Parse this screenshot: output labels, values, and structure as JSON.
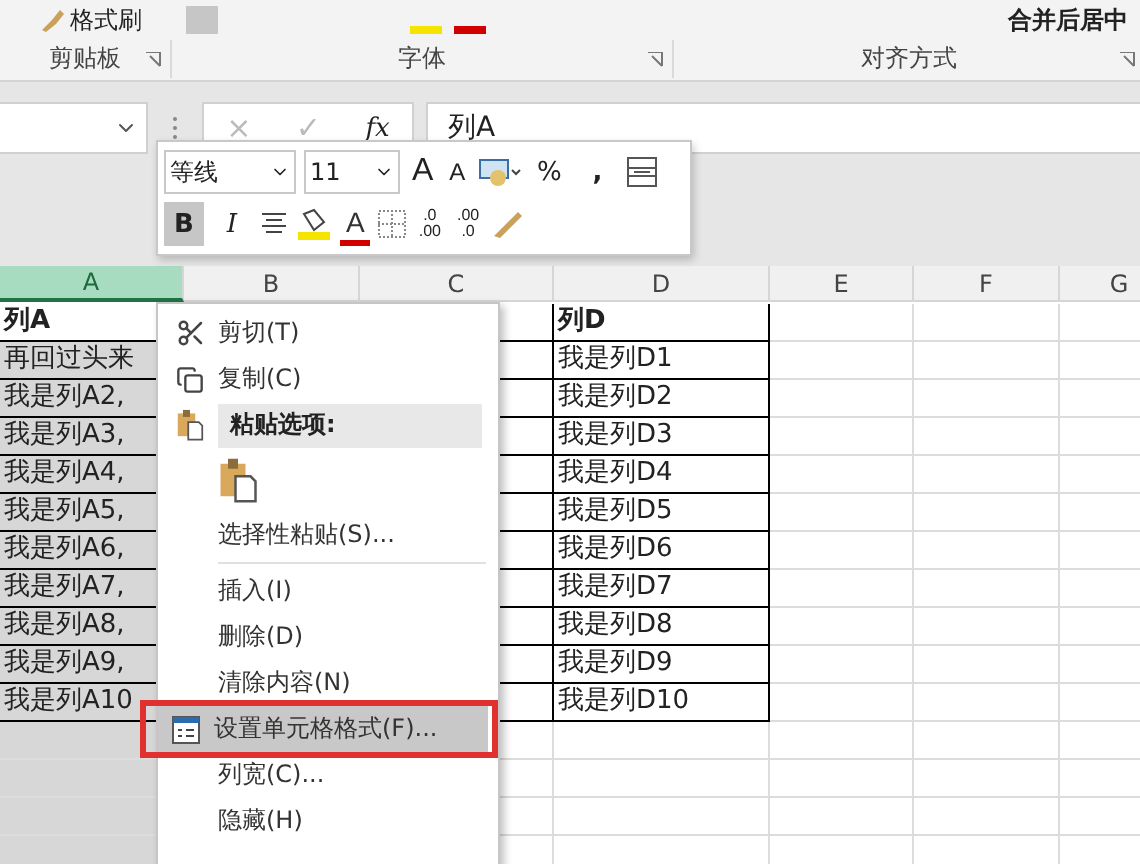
{
  "ribbon": {
    "format_painter": "格式刷",
    "merge_button": "合并后居中",
    "groups": [
      {
        "label": "剪贴板"
      },
      {
        "label": "字体"
      },
      {
        "label": "对齐方式"
      }
    ]
  },
  "formula_bar": {
    "cancel": "×",
    "enter": "✓",
    "fx": "fx",
    "value": "列A"
  },
  "columns": [
    {
      "label": "A",
      "selected": true
    },
    {
      "label": "B",
      "selected": false
    },
    {
      "label": "C",
      "selected": false
    },
    {
      "label": "D",
      "selected": false
    },
    {
      "label": "E",
      "selected": false
    },
    {
      "label": "F",
      "selected": false
    },
    {
      "label": "G",
      "selected": false
    }
  ],
  "rows": [
    {
      "a": "列A",
      "d": "列D",
      "header": true,
      "active": true
    },
    {
      "a": "再回过头来",
      "d": "我是列D1",
      "header": false,
      "active": false
    },
    {
      "a": "我是列A2,",
      "d": "我是列D2",
      "header": false,
      "active": false
    },
    {
      "a": "我是列A3,",
      "d": "我是列D3",
      "header": false,
      "active": false
    },
    {
      "a": "我是列A4,",
      "d": "我是列D4",
      "header": false,
      "active": false
    },
    {
      "a": "我是列A5,",
      "d": "我是列D5",
      "header": false,
      "active": false
    },
    {
      "a": "我是列A6,",
      "d": "我是列D6",
      "header": false,
      "active": false
    },
    {
      "a": "我是列A7,",
      "d": "我是列D7",
      "header": false,
      "active": false
    },
    {
      "a": "我是列A8,",
      "d": "我是列D8",
      "header": false,
      "active": false
    },
    {
      "a": "我是列A9,",
      "d": "我是列D9",
      "header": false,
      "active": false
    },
    {
      "a": "我是列A10",
      "d": "我是列D10",
      "header": false,
      "active": false
    }
  ],
  "mini_toolbar": {
    "font": "等线",
    "size": "11",
    "grow": "A",
    "shrink": "A",
    "percent": "%",
    "comma": ",",
    "bold": "B",
    "bold_pressed": true,
    "italic": "I",
    "font_color": "A",
    "dec_inc": [
      ".0",
      ".00"
    ],
    "dec_dec": [
      ".00",
      ".0"
    ]
  },
  "context_menu": [
    {
      "kind": "cut",
      "label": "剪切(T)",
      "highlighted": false,
      "annotated": false
    },
    {
      "kind": "copy",
      "label": "复制(C)",
      "highlighted": false,
      "annotated": false
    },
    {
      "kind": "header",
      "label": "粘贴选项:"
    },
    {
      "kind": "paste"
    },
    {
      "kind": "plain",
      "label": "选择性粘贴(S)...",
      "highlighted": false,
      "annotated": false
    },
    {
      "kind": "separator"
    },
    {
      "kind": "plain",
      "label": "插入(I)",
      "highlighted": false,
      "annotated": false
    },
    {
      "kind": "plain",
      "label": "删除(D)",
      "highlighted": false,
      "annotated": false
    },
    {
      "kind": "plain",
      "label": "清除内容(N)",
      "highlighted": false,
      "annotated": false
    },
    {
      "kind": "format",
      "label": "设置单元格格式(F)...",
      "highlighted": true,
      "annotated": true
    },
    {
      "kind": "plain",
      "label": "列宽(C)...",
      "highlighted": false,
      "annotated": false
    },
    {
      "kind": "plain",
      "label": "隐藏(H)",
      "highlighted": false,
      "annotated": false
    }
  ]
}
